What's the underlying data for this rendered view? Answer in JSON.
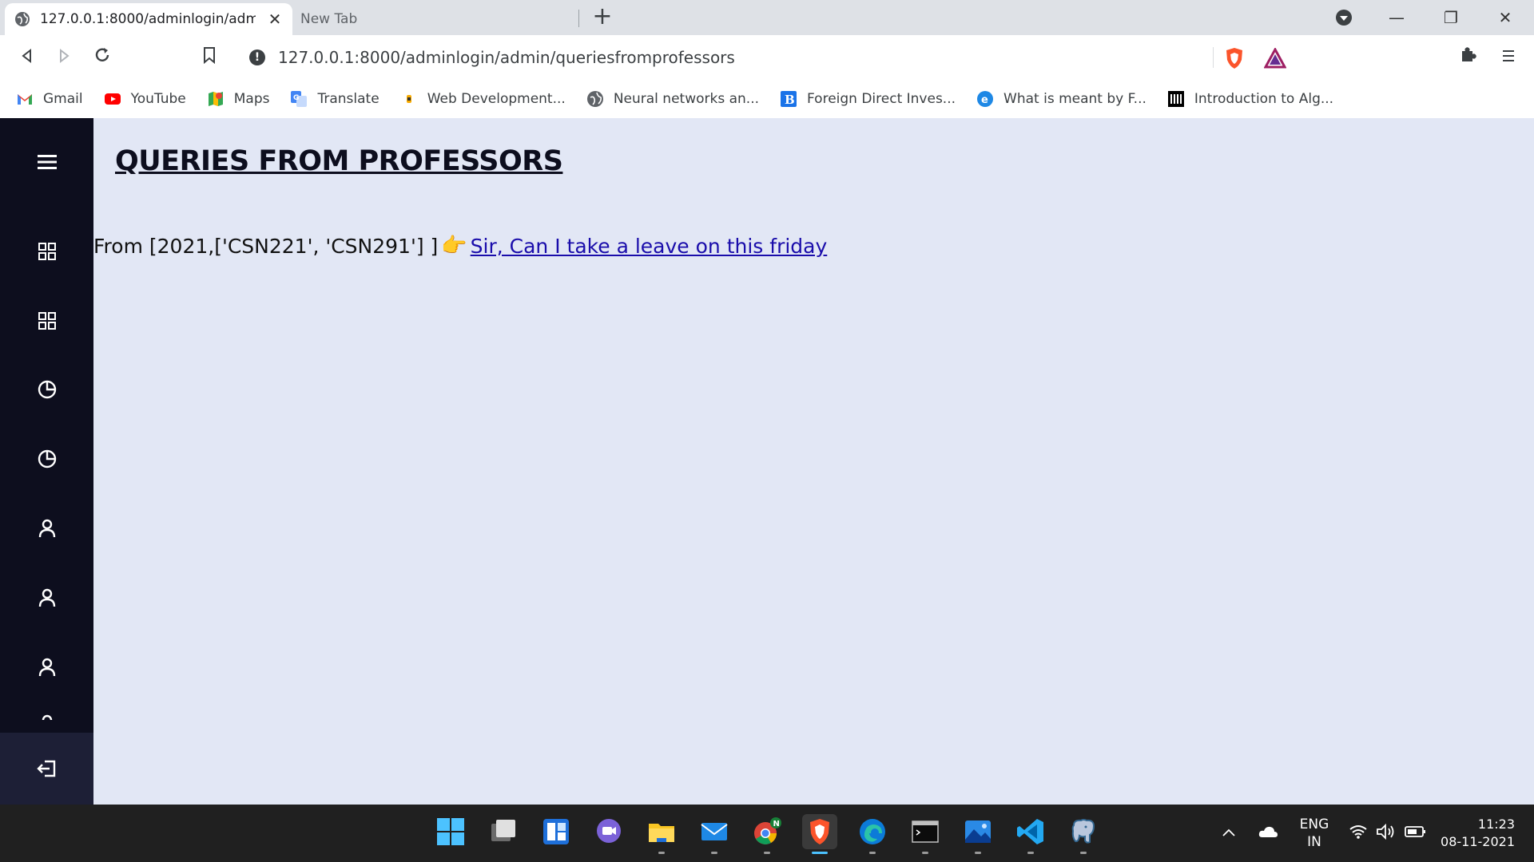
{
  "browser": {
    "active_tab_title": "127.0.0.1:8000/adminlogin/admin/queriesfromprofessors",
    "inactive_tab_title": "New Tab",
    "url": "127.0.0.1:8000/adminlogin/admin/queriesfromprofessors"
  },
  "bookmarks": [
    {
      "label": "Gmail",
      "icon": "gmail-icon",
      "color": "#ea4335"
    },
    {
      "label": "YouTube",
      "icon": "youtube-icon",
      "color": "#ff0000"
    },
    {
      "label": "Maps",
      "icon": "maps-icon",
      "color": "#34a853"
    },
    {
      "label": "Translate",
      "icon": "translate-icon",
      "color": "#4285f4"
    },
    {
      "label": "Web Development...",
      "icon": "webdev-icon",
      "color": "#f9ab00"
    },
    {
      "label": "Neural networks an...",
      "icon": "globe-icon",
      "color": "#5f6368"
    },
    {
      "label": "Foreign Direct Inves...",
      "icon": "b-icon",
      "color": "#1a73e8"
    },
    {
      "label": "What is meant by F...",
      "icon": "e-icon",
      "color": "#1e88e5"
    },
    {
      "label": "Introduction to Alg...",
      "icon": "algo-icon",
      "color": "#000000"
    }
  ],
  "page": {
    "title": "QUERIES FROM PROFESSORS",
    "query_from": "From [2021,['CSN221', 'CSN291'] ]",
    "query_link": "Sir, Can I take a leave on this friday"
  },
  "sidebar_icons": [
    "menu-icon",
    "grid-icon",
    "grid-icon",
    "chart-icon",
    "chart-icon",
    "user-icon",
    "user-icon",
    "user-icon",
    "logout-icon"
  ],
  "tray": {
    "lang_top": "ENG",
    "lang_bottom": "IN",
    "time": "11:23",
    "date": "08-11-2021"
  },
  "colors": {
    "sidebar": "#0d0e1e",
    "main_bg": "#e2e7f5",
    "link": "#1a0dab"
  }
}
